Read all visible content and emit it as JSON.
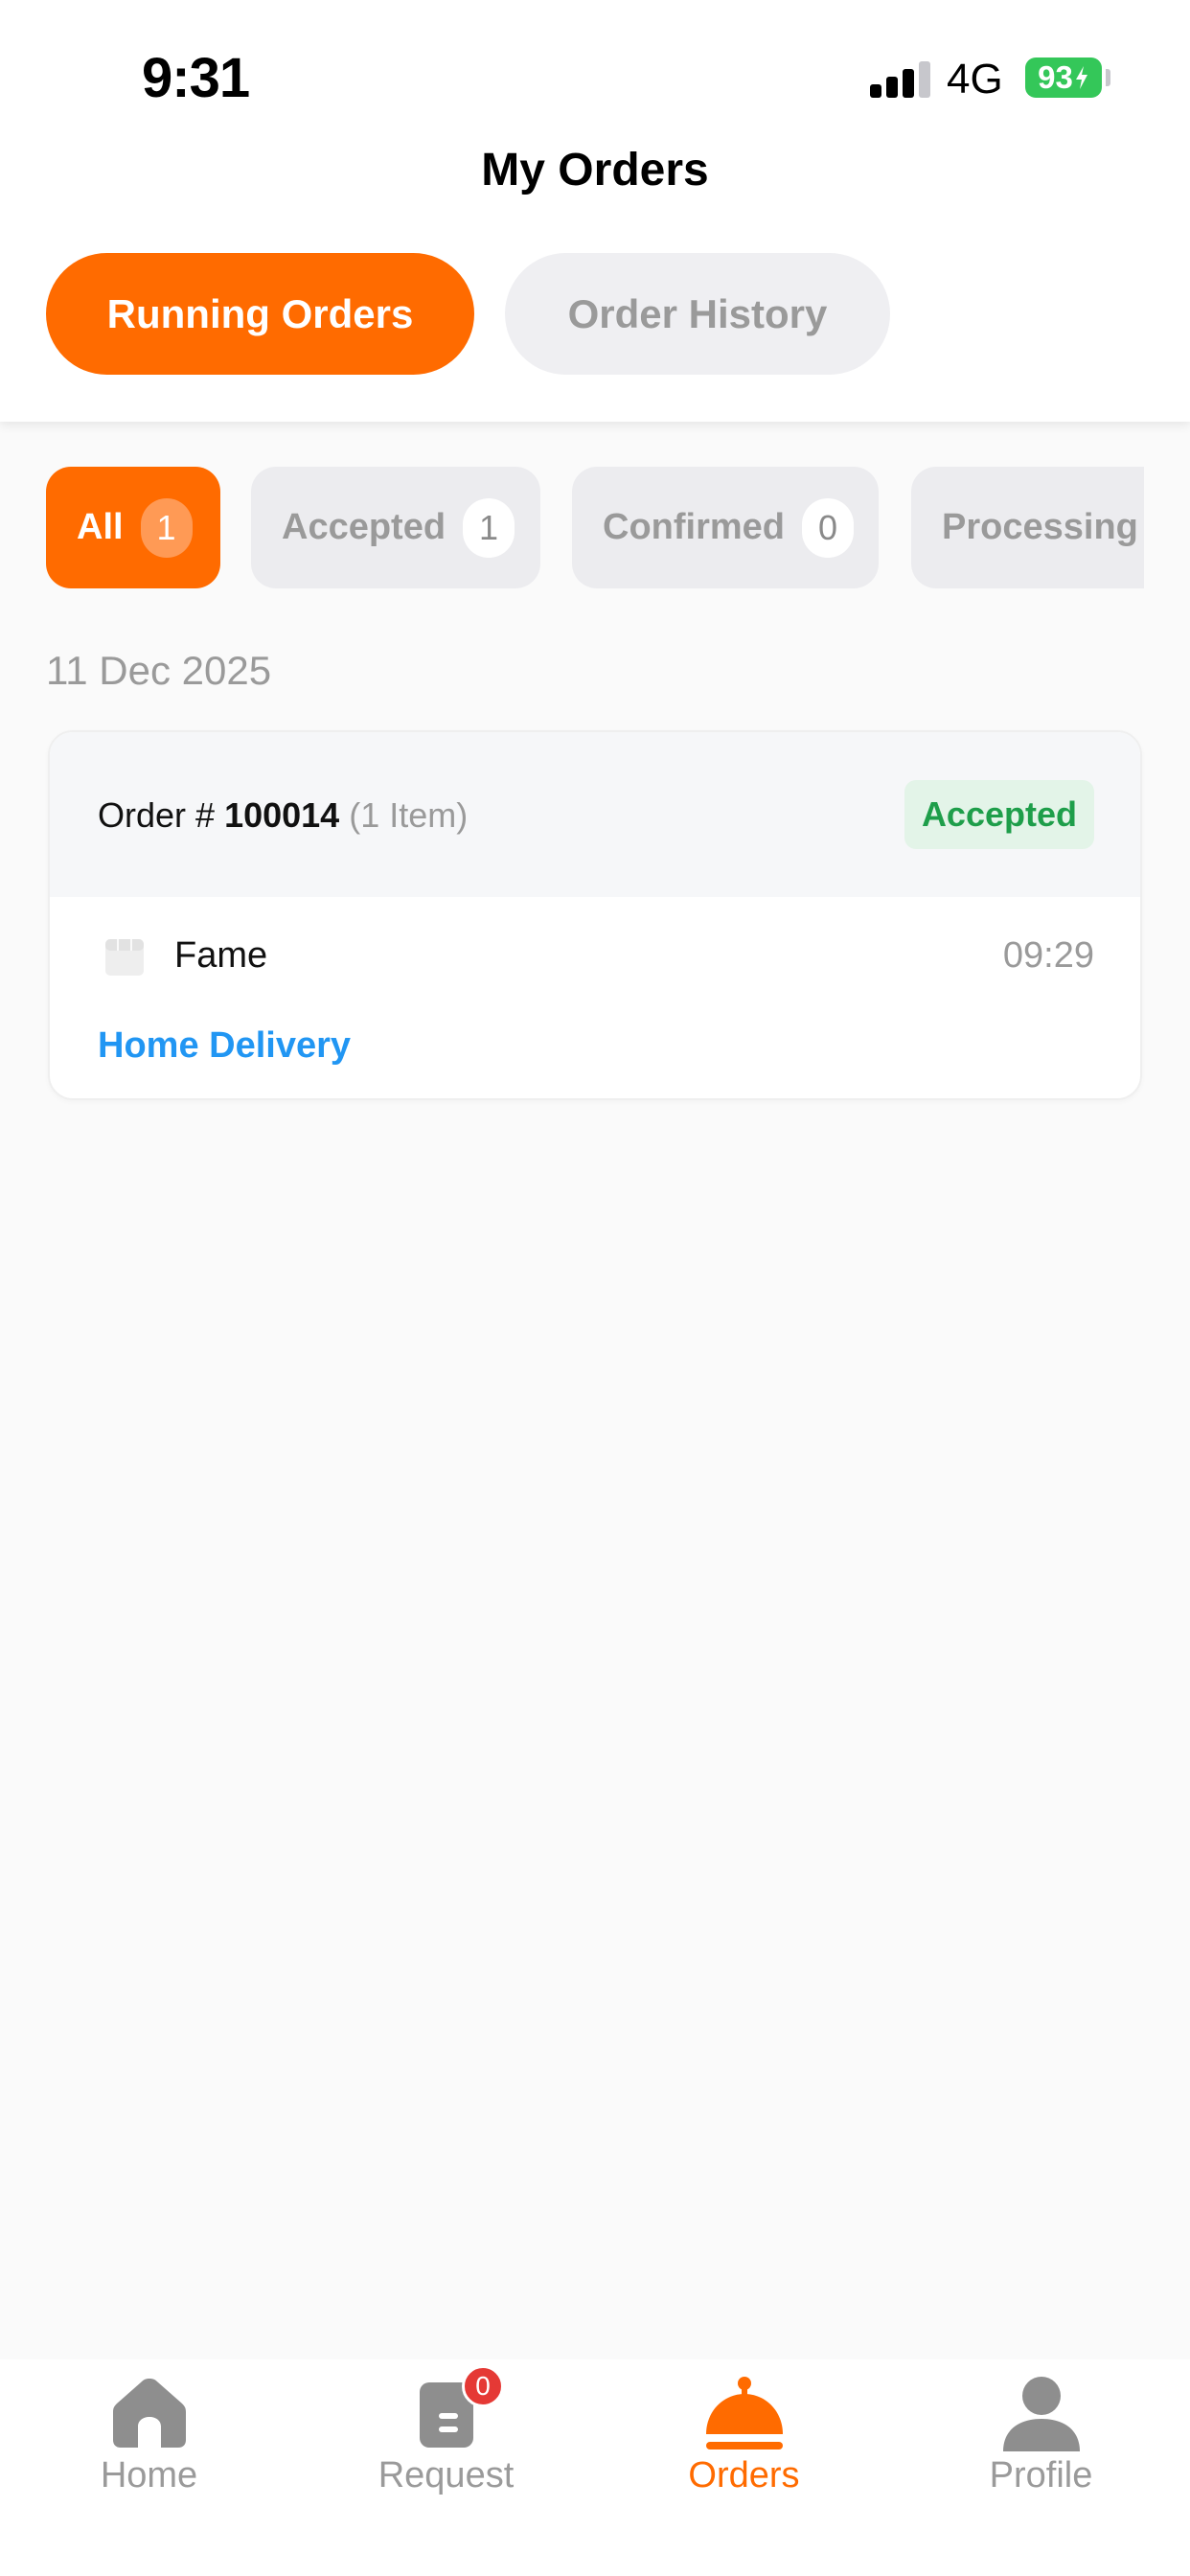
{
  "status_bar": {
    "time": "9:31",
    "network": "4G",
    "battery": "93"
  },
  "header": {
    "title": "My Orders",
    "tabs": [
      {
        "label": "Running Orders",
        "active": true
      },
      {
        "label": "Order History",
        "active": false
      }
    ]
  },
  "filters": [
    {
      "label": "All",
      "count": "1",
      "active": true
    },
    {
      "label": "Accepted",
      "count": "1"
    },
    {
      "label": "Confirmed",
      "count": "0"
    },
    {
      "label": "Processing"
    }
  ],
  "orders_section": {
    "date": "11 Dec 2025",
    "order": {
      "prefix": "Order #",
      "number": "100014",
      "items": "(1 Item)",
      "status": "Accepted",
      "store_icon": "store-icon",
      "store": "Fame",
      "time": "09:29",
      "delivery_type": "Home Delivery"
    }
  },
  "bottom_nav": {
    "items": [
      {
        "label": "Home",
        "icon": "home-icon"
      },
      {
        "label": "Request",
        "icon": "clipboard-icon",
        "badge": "0"
      },
      {
        "label": "Orders",
        "icon": "cloche-icon",
        "active": true
      },
      {
        "label": "Profile",
        "icon": "person-icon"
      }
    ]
  },
  "colors": {
    "accent": "#ff6b00",
    "status_green": "#1e9e4a",
    "link_blue": "#2196f3",
    "badge_red": "#e53935",
    "battery_green": "#34c759"
  }
}
